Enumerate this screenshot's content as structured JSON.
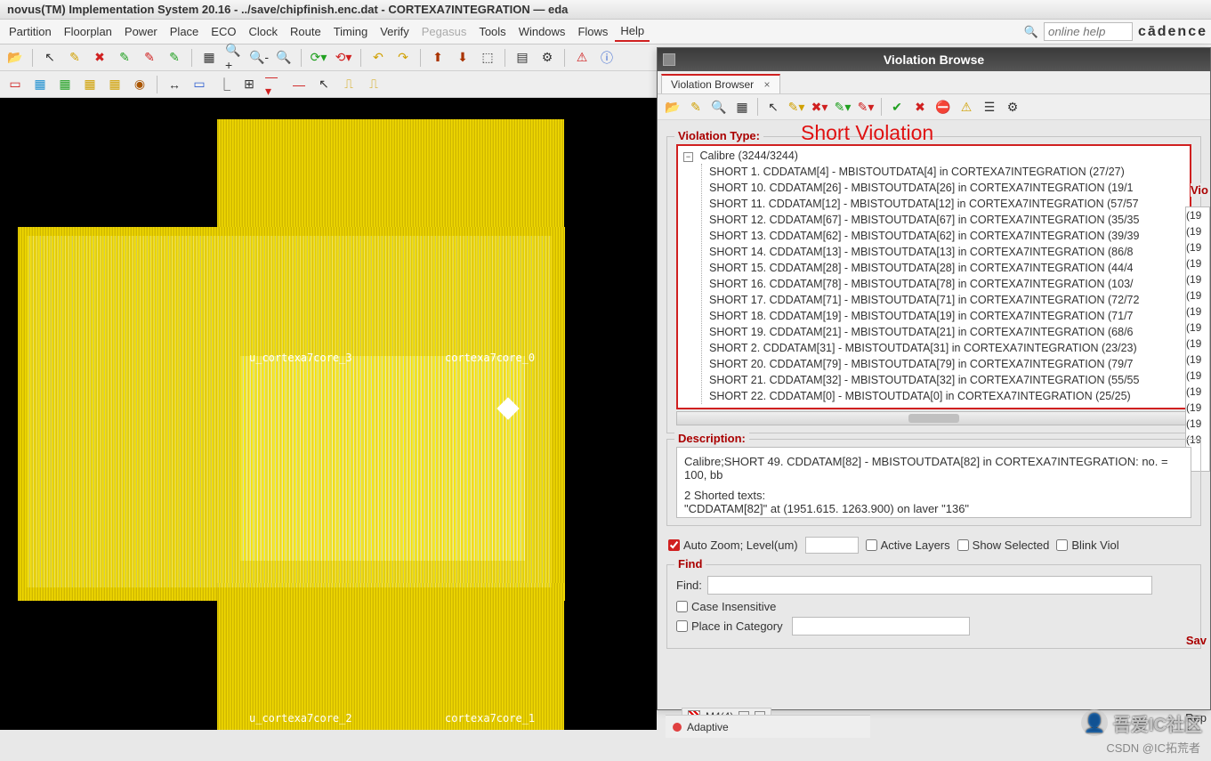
{
  "window": {
    "title": "novus(TM) Implementation System 20.16 - ../save/chipfinish.enc.dat - CORTEXA7INTEGRATION — eda"
  },
  "menu": {
    "partition": "Partition",
    "floorplan": "Floorplan",
    "power": "Power",
    "place": "Place",
    "eco": "ECO",
    "clock": "Clock",
    "route": "Route",
    "timing": "Timing",
    "verify": "Verify",
    "pegasus": "Pegasus",
    "tools": "Tools",
    "windows": "Windows",
    "flows": "Flows",
    "help": "Help"
  },
  "search": {
    "placeholder": "online help"
  },
  "brand": "cādence",
  "layout": {
    "core_labels": [
      "u_cortexa7core_3",
      "cortexa7core_0",
      "u_cortexa7core_2",
      "cortexa7core_1"
    ]
  },
  "status": {
    "mode": "Adaptive",
    "layerbox": "M4(4)"
  },
  "vb": {
    "title": "Violation Browse",
    "tab": "Violation Browser",
    "section_type": "Violation Type:",
    "annotation": "Short Violation",
    "side_label_vio": "Vio",
    "side_label_sav": "Sav",
    "side_label_rep": "Rep",
    "tree_root": "Calibre (3244/3244)",
    "tree_items": [
      "SHORT 1.  CDDATAM[4] - MBISTOUTDATA[4] in CORTEXA7INTEGRATION (27/27)",
      "SHORT 10.  CDDATAM[26] - MBISTOUTDATA[26] in CORTEXA7INTEGRATION (19/1",
      "SHORT 11.  CDDATAM[12] - MBISTOUTDATA[12] in CORTEXA7INTEGRATION (57/57",
      "SHORT 12.  CDDATAM[67] - MBISTOUTDATA[67] in CORTEXA7INTEGRATION (35/35",
      "SHORT 13.  CDDATAM[62] - MBISTOUTDATA[62] in CORTEXA7INTEGRATION (39/39",
      "SHORT 14.  CDDATAM[13] - MBISTOUTDATA[13] in CORTEXA7INTEGRATION (86/8",
      "SHORT 15.  CDDATAM[28] - MBISTOUTDATA[28] in CORTEXA7INTEGRATION (44/4",
      "SHORT 16.  CDDATAM[78] - MBISTOUTDATA[78] in CORTEXA7INTEGRATION (103/",
      "SHORT 17.  CDDATAM[71] - MBISTOUTDATA[71] in CORTEXA7INTEGRATION (72/72",
      "SHORT 18.  CDDATAM[19] - MBISTOUTDATA[19] in CORTEXA7INTEGRATION (71/7",
      "SHORT 19.  CDDATAM[21] - MBISTOUTDATA[21] in CORTEXA7INTEGRATION (68/6",
      "SHORT 2.  CDDATAM[31] - MBISTOUTDATA[31] in CORTEXA7INTEGRATION (23/23)",
      "SHORT 20.  CDDATAM[79] - MBISTOUTDATA[79] in CORTEXA7INTEGRATION (79/7",
      "SHORT 21.  CDDATAM[32] - MBISTOUTDATA[32] in CORTEXA7INTEGRATION (55/55",
      "SHORT 22.  CDDATAM[0] - MBISTOUTDATA[0] in CORTEXA7INTEGRATION (25/25)"
    ],
    "side_list": [
      "(19",
      "(19",
      "(19",
      "(19",
      "(19",
      "(19",
      "(19",
      "(19",
      "(19",
      "(19",
      "(19",
      "(19",
      "(19",
      "(19",
      "(19"
    ],
    "desc_label": "Description:",
    "desc_line1": "Calibre;SHORT 49.  CDDATAM[82] - MBISTOUTDATA[82] in CORTEXA7INTEGRATION: no. = 100, bb",
    "desc_line2": "2 Shorted texts:",
    "desc_line3": "\"CDDATAM[82]\" at (1951.615. 1263.900) on laver \"136\"",
    "auto_zoom": "Auto Zoom;  Level(um)",
    "active_layers": "Active Layers",
    "show_selected": "Show Selected",
    "blink_viol": "Blink Viol",
    "find_label": "Find",
    "find_field": "Find:",
    "case_insensitive": "Case Insensitive",
    "place_in_category": "Place in Category"
  },
  "watermark": {
    "text": "吾爱IC社区",
    "csdn": "CSDN @IC拓荒者"
  }
}
